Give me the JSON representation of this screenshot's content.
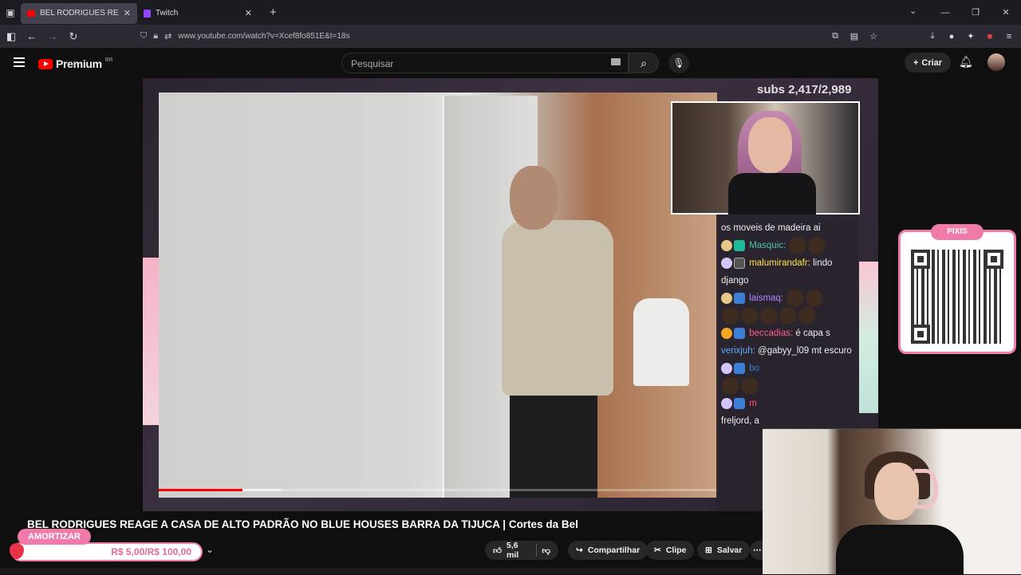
{
  "browser": {
    "tabs": [
      {
        "title": "BEL RODRIGUES REAGE A C",
        "active": true
      },
      {
        "title": "Twitch",
        "active": false
      }
    ],
    "url": "www.youtube.com/watch?v=Xcef8fo851E&t=18s"
  },
  "youtube": {
    "logo_text": "Premium",
    "region": "BR",
    "search_placeholder": "Pesquisar",
    "create_label": "Criar"
  },
  "video": {
    "title": "BEL RODRIGUES REAGE A CASA DE ALTO PADRÃO NO BLUE HOUSES BARRA DA TIJUCA | Cortes da Bel",
    "progress_fraction": 0.15,
    "buffered_fraction": 0.22,
    "likes": "5,6 mil",
    "share_label": "Compartilhar",
    "clip_label": "Clipe",
    "save_label": "Salvar"
  },
  "overlay": {
    "subs_text": "subs 2,417/2,989",
    "qr_label": "PIXIS",
    "amortizar_label": "AMORTIZAR",
    "amortizar_value": "R$ 5,00/R$ 100,00"
  },
  "chat": [
    {
      "user": "",
      "text": "os moveis de madeira ai",
      "color": "#eeeeee"
    },
    {
      "user": "Masquic:",
      "text": "",
      "color": "#4fc3a6"
    },
    {
      "user": "malumirandafr:",
      "text": "lindo django",
      "color": "#ffe14d"
    },
    {
      "user": "laismaq:",
      "text": "",
      "color": "#b084ff"
    },
    {
      "user": "beccadias:",
      "text": "é capa s",
      "color": "#ff5c8a"
    },
    {
      "user": "verixjuh:",
      "text": "@gabyy_l09 mt escuro",
      "color": "#5fa8ff"
    },
    {
      "user": "bo",
      "text": "",
      "color": "#3d7fd6"
    },
    {
      "user": "m",
      "text": "freljord, a",
      "color": "#ff4d6a"
    }
  ],
  "colors": {
    "accent_pink": "#f07bab",
    "youtube_red": "#ff0000",
    "background": "#0f0f0f"
  }
}
